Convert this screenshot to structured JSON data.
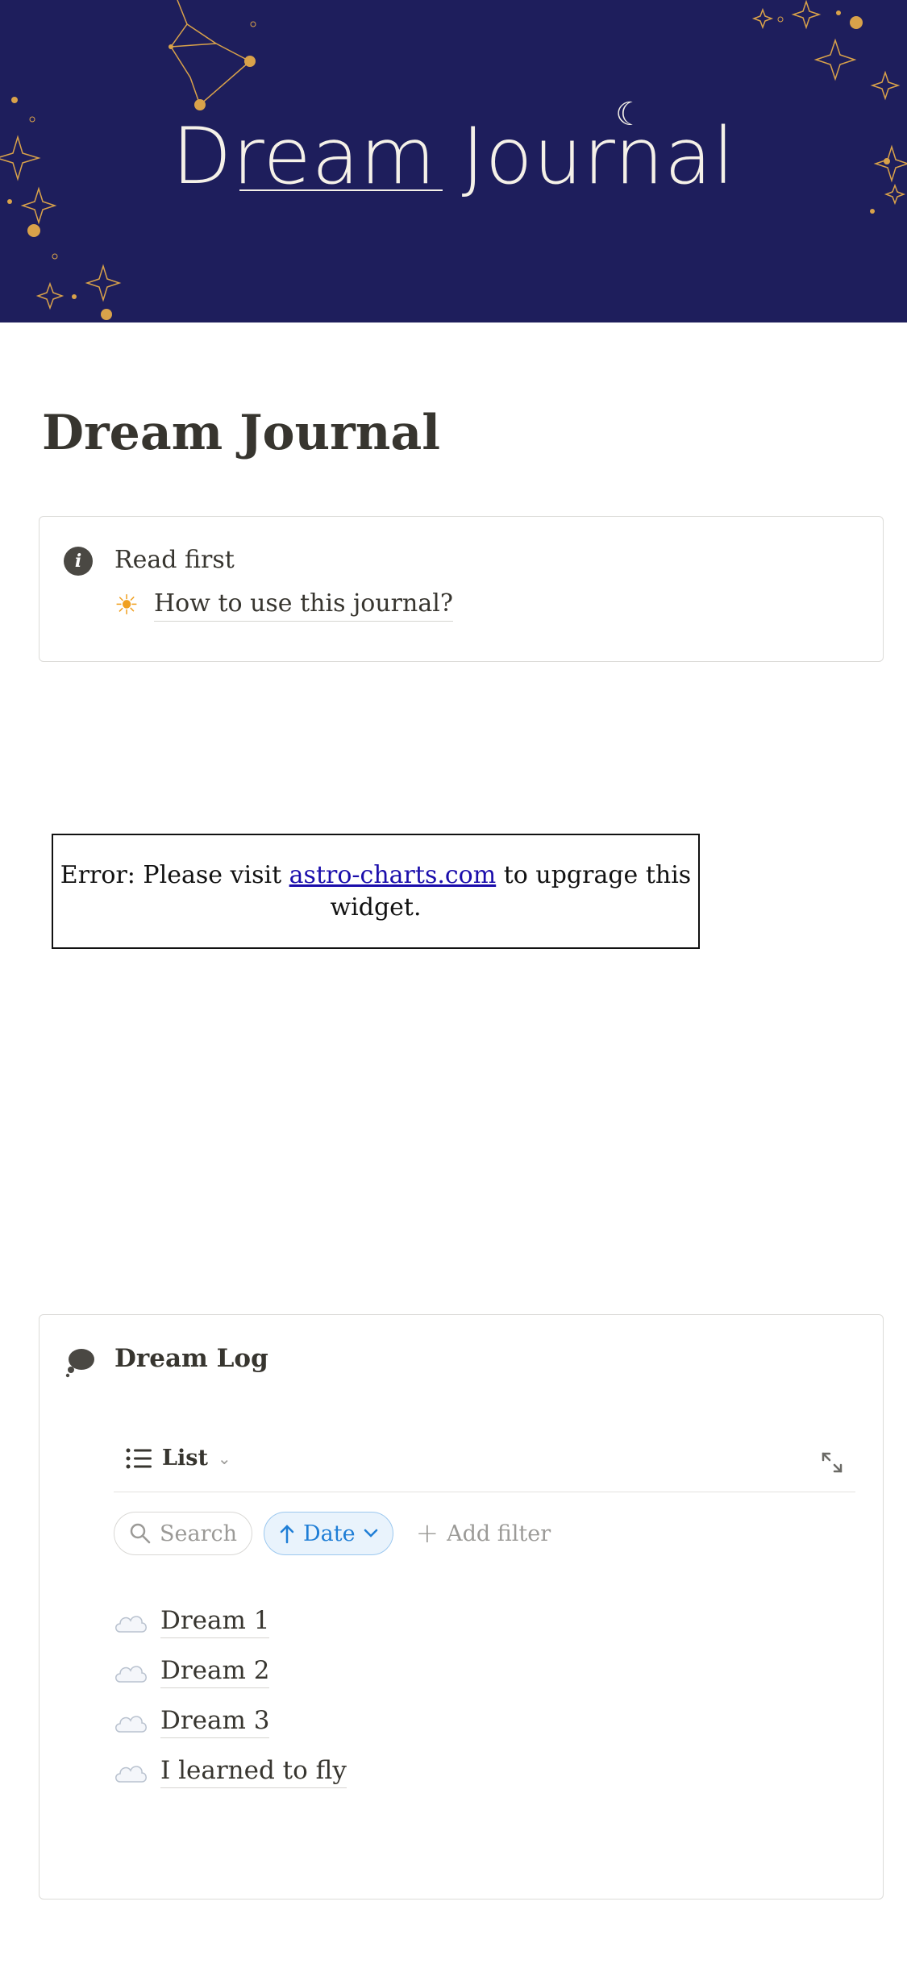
{
  "cover": {
    "title": "Dream Journal"
  },
  "page": {
    "title": "Dream Journal",
    "icon": "crescent-moon-icon"
  },
  "callout": {
    "icon": "info-icon",
    "heading": "Read first",
    "link_icon": "sun-icon",
    "link_text": "How to use this journal?"
  },
  "widget": {
    "prefix": "Error: Please visit ",
    "link_text": "astro-charts.com",
    "suffix": " to upgrage this widget."
  },
  "database": {
    "icon": "thought-bubble-icon",
    "title": "Dream Log",
    "view": {
      "icon": "list-icon",
      "label": "List"
    },
    "filters": {
      "search_label": "Search",
      "sort_label": "Date",
      "add_filter_label": "Add filter"
    },
    "rows": [
      {
        "icon": "cloud-icon",
        "title": "Dream 1"
      },
      {
        "icon": "cloud-icon",
        "title": "Dream 2"
      },
      {
        "icon": "cloud-icon",
        "title": "Dream 3"
      },
      {
        "icon": "cloud-icon",
        "title": "I learned to fly"
      }
    ]
  },
  "colors": {
    "cover_bg": "#1e1e5c",
    "star_gold": "#d9a24a",
    "sort_blue": "#1f7ed6"
  }
}
